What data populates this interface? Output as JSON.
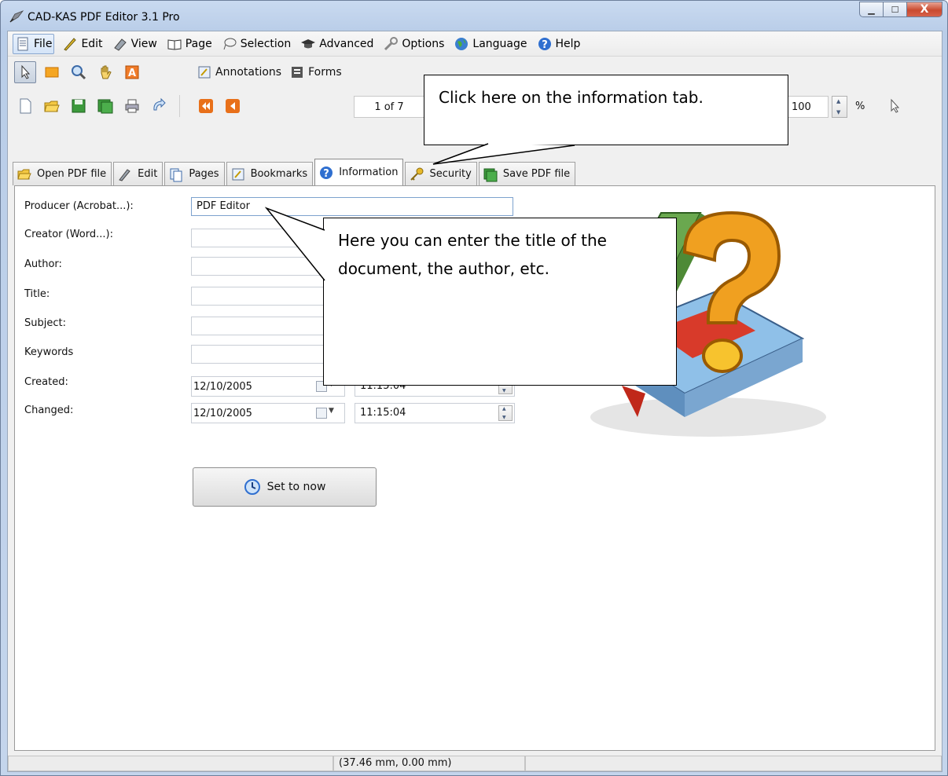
{
  "window": {
    "title": "CAD-KAS PDF Editor 3.1 Pro",
    "controls": [
      "minimize",
      "maximize",
      "close"
    ],
    "close_glyph": "X"
  },
  "menu": {
    "items": [
      {
        "label": "File",
        "icon": "file-icon"
      },
      {
        "label": "Edit",
        "icon": "edit-icon"
      },
      {
        "label": "View",
        "icon": "view-icon"
      },
      {
        "label": "Page",
        "icon": "book-icon"
      },
      {
        "label": "Selection",
        "icon": "lasso-icon"
      },
      {
        "label": "Advanced",
        "icon": "graduation-cap-icon"
      },
      {
        "label": "Options",
        "icon": "wrench-icon"
      },
      {
        "label": "Language",
        "icon": "globe-icon"
      },
      {
        "label": "Help",
        "icon": "help-icon"
      }
    ]
  },
  "toolbar": {
    "annotations_label": "Annotations",
    "forms_label": "Forms",
    "page_indicator": "1 of 7",
    "zoom_value": "100",
    "zoom_unit": "%"
  },
  "tabs": [
    {
      "label": "Open PDF file",
      "icon": "open-folder-icon"
    },
    {
      "label": "Edit",
      "icon": "pen-icon"
    },
    {
      "label": "Pages",
      "icon": "pages-icon"
    },
    {
      "label": "Bookmarks",
      "icon": "bookmark-icon"
    },
    {
      "label": "Information",
      "icon": "info-icon",
      "active": true
    },
    {
      "label": "Security",
      "icon": "key-icon"
    },
    {
      "label": "Save PDF file",
      "icon": "save-icon"
    }
  ],
  "form": {
    "producer_label": "Producer (Acrobat...):",
    "producer_value": "PDF Editor",
    "creator_label": "Creator (Word...):",
    "creator_value": "",
    "author_label": "Author:",
    "author_value": "",
    "title_label": "Title:",
    "title_value": "",
    "subject_label": "Subject:",
    "subject_value": "",
    "keywords_label": "Keywords",
    "keywords_value": "",
    "created_label": "Created:",
    "created_date": "12/10/2005",
    "created_time": "11:15:04",
    "changed_label": "Changed:",
    "changed_date": "12/10/2005",
    "changed_time": "11:15:04",
    "set_now_label": "Set to now"
  },
  "status": {
    "coords": "(37.46 mm, 0.00 mm)"
  },
  "callouts": {
    "tab_hint": "Click here on the information tab.",
    "form_hint_line1": "Here you can enter the title of the",
    "form_hint_line2": "document, the author, etc."
  },
  "colors": {
    "titlebar": "#c9daf0",
    "close_button": "#c94a2f",
    "panel_bg": "#ffffff",
    "book_green": "#6aa84f",
    "question_orange": "#f0a020"
  }
}
